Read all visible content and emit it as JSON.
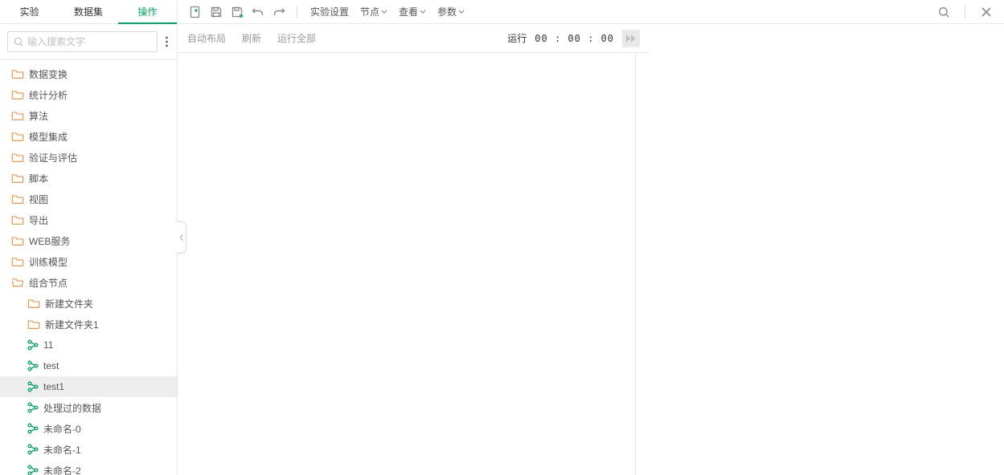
{
  "sidebar": {
    "tabs": [
      "实验",
      "数据集",
      "操作"
    ],
    "active_tab_index": 2,
    "search_placeholder": "输入搜索文字",
    "tree": {
      "folders": [
        "数据变换",
        "统计分析",
        "算法",
        "模型集成",
        "验证与评估",
        "脚本",
        "视图",
        "导出",
        "WEB服务",
        "训练模型",
        "组合节点"
      ],
      "children": [
        "新建文件夹",
        "新建文件夹1",
        "11",
        "test",
        "test1",
        "处理过的数据",
        "未命名-0",
        "未命名-1",
        "未命名-2"
      ],
      "child_types": [
        "folder",
        "folder",
        "node",
        "node",
        "node",
        "node",
        "node",
        "node",
        "node"
      ],
      "selected_child": "test1"
    }
  },
  "toolbar": {
    "experiment_settings": "实验设置",
    "menus": [
      "节点",
      "查看",
      "参数"
    ]
  },
  "canvas_bar": {
    "auto_layout": "自动布局",
    "refresh": "刷新",
    "run_all": "运行全部",
    "run_label": "运行",
    "timer": "00 : 00 : 00"
  },
  "colors": {
    "accent": "#00a862",
    "folder": "#f08b36"
  }
}
